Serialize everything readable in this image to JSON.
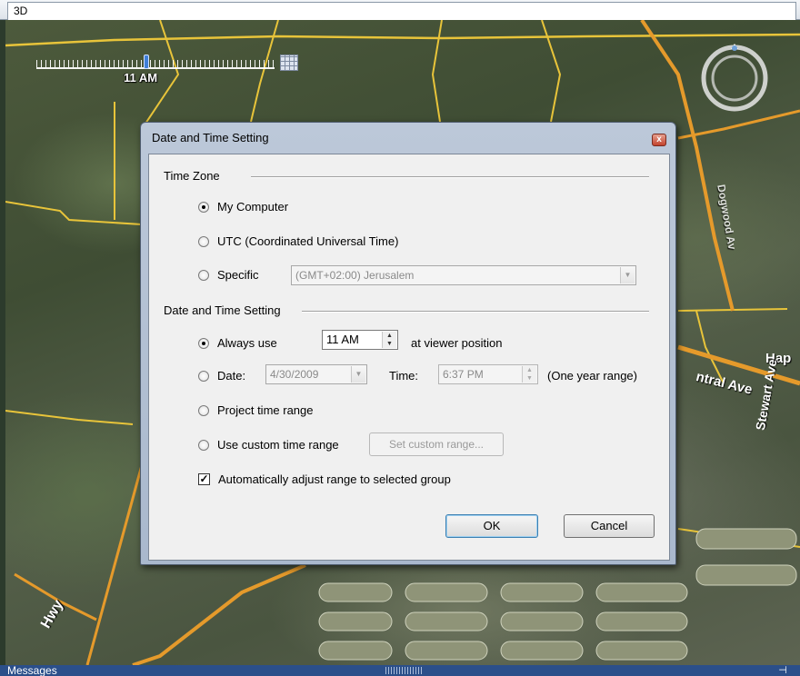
{
  "window": {
    "tab_label": "3D"
  },
  "map": {
    "time_label": "11 AM",
    "labels": {
      "avenue": "ntral Ave",
      "stewart": "Stewart Ave",
      "hap": "Hap",
      "hwy": "Hwy",
      "dogwood": "Dogwood Av"
    }
  },
  "statusbar": {
    "label": "Messages"
  },
  "dialog": {
    "title": "Date and Time Setting",
    "close_label": "x",
    "time_zone": {
      "heading": "Time Zone",
      "my_computer": "My Computer",
      "utc": "UTC (Coordinated Universal Time)",
      "specific": "Specific",
      "specific_value": "(GMT+02:00) Jerusalem",
      "selected": "my_computer"
    },
    "date_time": {
      "heading": "Date and Time Setting",
      "always_use": "Always use",
      "always_use_value": "11 AM",
      "at_viewer": "at viewer position",
      "date_label": "Date:",
      "date_value": "4/30/2009",
      "time_label": "Time:",
      "time_value": "6:37 PM",
      "range_note": "(One year range)",
      "project_range": "Project time range",
      "custom_range": "Use custom time range",
      "set_custom_button": "Set custom range...",
      "auto_adjust": "Automatically adjust range to selected group",
      "auto_adjust_checked": true,
      "selected": "always_use"
    },
    "ok_label": "OK",
    "cancel_label": "Cancel"
  }
}
